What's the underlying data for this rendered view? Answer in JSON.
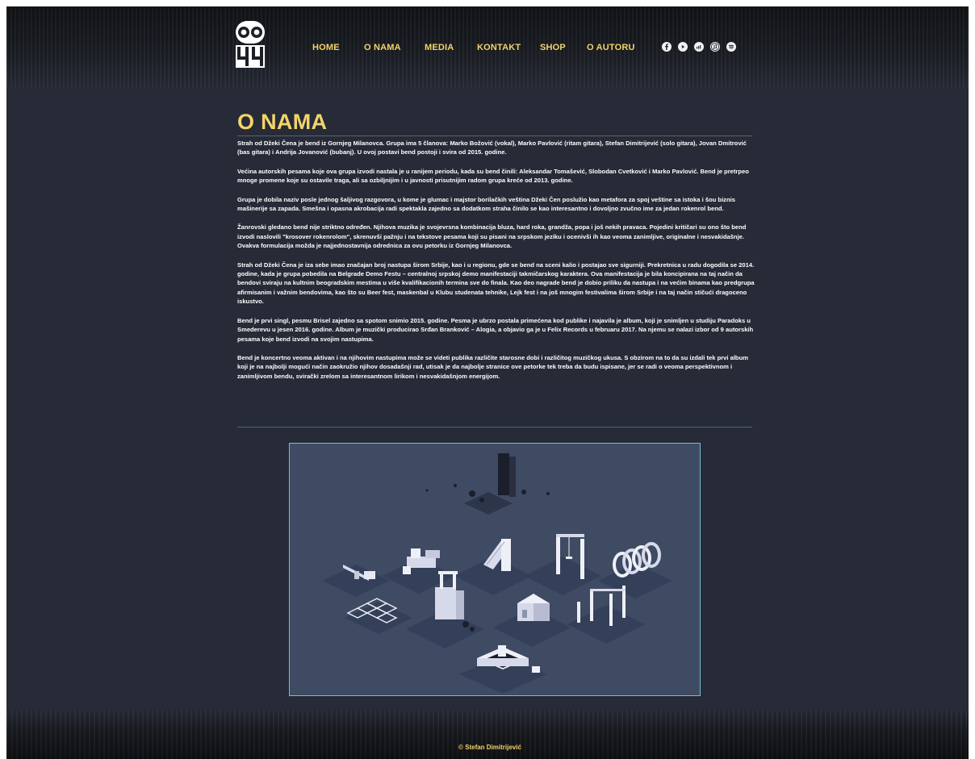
{
  "header": {
    "logo_text": "GO 44",
    "nav": [
      {
        "label": "HOME",
        "name": "nav-home"
      },
      {
        "label": "O NAMA",
        "name": "nav-o-nama"
      },
      {
        "label": "MEDIA",
        "name": "nav-media"
      },
      {
        "label": "KONTAKT",
        "name": "nav-kontakt"
      },
      {
        "label": "SHOP",
        "name": "nav-shop"
      },
      {
        "label": "O AUTORU",
        "name": "nav-o-autoru"
      }
    ],
    "social_icons": [
      "facebook-icon",
      "youtube-icon",
      "deezer-icon",
      "apple-music-icon",
      "spotify-icon"
    ]
  },
  "page": {
    "title": "O NAMA",
    "paragraphs": [
      "Strah od Džeki Čena je bend iz Gornjeg Milanovca. Grupa ima 5 članova: Marko Božović (vokal), Marko Pavlović (ritam gitara), Stefan Dimitrijević (solo gitara), Jovan Dmitrović (bas gitara) i Andrija Jovanović (bubanj). U ovoj postavi bend postoji i svira od 2015. godine.",
      "Većina autorskih pesama koje ova grupa izvodi nastala je u ranijem periodu, kada su bend činili: Aleksandar Tomašević, Slobodan Cvetković i Marko Pavlović. Bend je pretrpeo mnoge promene koje su ostavile traga, ali sa ozbiljnijim i u javnosti prisutnijim radom grupa kreće od 2013. godine.",
      "Grupa je dobila naziv posle jednog šaljivog razgovora, u kome je glumac i majstor borilačkih veština Džeki Čen poslužio kao metafora za spoj veštine sa istoka i šou biznis mašinerije sa zapada. Smešna i opasna akrobacija radi spektakla zajedno sa dodatkom straha činilo se kao interesantno i dovoljno zvučno ime za jedan rokenrol bend.",
      "Žanrovski gledano bend nije striktno određen. Njihova muzika je svojevrsna kombinacija bluza, hard roka, grandža, popa i još nekih pravaca. Pojedini kritičari su ono što bend izvodi naslovili \"krosover rokenrolom\", skrenuvši pažnju i na tekstove pesama koji su pisani na srpskom jeziku i ocenivši ih kao veoma zanimljive, originalne i nesvakidašnje. Ovakva formulacija možda je najjednostavnija odrednica za ovu petorku iz Gornjeg Milanovca.",
      "Strah od Džeki Čena je iza sebe imao značajan broj nastupa širom Srbije, kao i u regionu, gde se bend na sceni kalio i postajao sve sigurniji. Prekretnica u radu dogodila se 2014. godine, kada je grupa pobedila na Belgrade Demo Festu – centralnoj srpskoj demo manifestaciji takmičarskog karaktera. Ova manifestacija je bila koncipirana na taj način da bendovi sviraju na kultnim beogradskim mestima u više kvalifikacionih termina sve do finala. Kao deo nagrade bend je dobio priliku da nastupa i na većim binama kao predgrupa afirmisanim i važnim bendovima, kao što su Beer fest, maskenbal u Klubu studenata tehnike, Lejk fest i na još mnogim festivalima širom Srbije i na taj način stičući dragoceno iskustvo.",
      "Bend je prvi singl, pesmu Brisel zajedno sa spotom snimio 2015. godine. Pesma je ubrzo postala primećena kod publike i najavila je album, koji je snimljen u studiju Paradoks u Smederevu u jesen 2016. godine. Album je muzički producirao Srđan Branković – Alogia, a objavio ga je u Felix Records u februaru 2017. Na njemu se nalazi izbor od 9 autorskih pesama koje bend izvodi na svojim nastupima.",
      "Bend je koncertno veoma aktivan i na njihovim nastupima može se videti publika različite starosne dobi i različitog muzičkog ukusa. S obzirom na to da su izdali tek prvi album koji je na najbolji mogući način zaokružio njihov dosadašnji rad, utisak je da najbolje stranice ove petorke tek treba da budu ispisane, jer se radi o veoma perspektivnom i zanimljivom bendu, svirački zrelom sa interesantnom lirikom i nesvakidašnjom energijom."
    ]
  },
  "footer": {
    "text": "© Stefan Dimitrijević"
  },
  "colors": {
    "accent": "#f3d36a",
    "background": "#262b37",
    "scene_background": "#3f4a63",
    "scene_border": "#73c1d4"
  }
}
